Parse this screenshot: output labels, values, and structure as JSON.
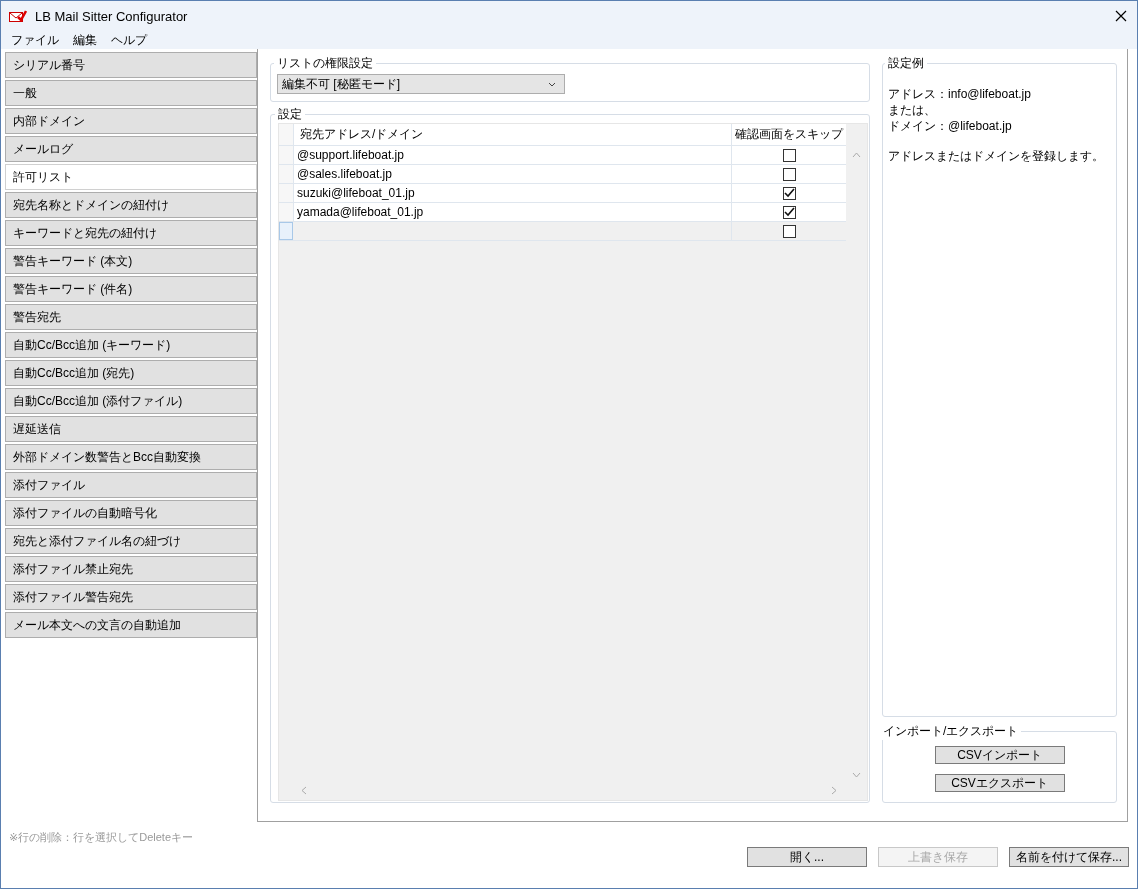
{
  "window": {
    "title": "LB Mail Sitter Configurator"
  },
  "menu": [
    "ファイル",
    "編集",
    "ヘルプ"
  ],
  "sidebar": {
    "items": [
      {
        "label": "シリアル番号",
        "selected": false
      },
      {
        "label": "一般",
        "selected": false
      },
      {
        "label": "内部ドメイン",
        "selected": false
      },
      {
        "label": "メールログ",
        "selected": false
      },
      {
        "label": "許可リスト",
        "selected": true
      },
      {
        "label": "宛先名称とドメインの紐付け",
        "selected": false
      },
      {
        "label": "キーワードと宛先の紐付け",
        "selected": false
      },
      {
        "label": "警告キーワード (本文)",
        "selected": false
      },
      {
        "label": "警告キーワード (件名)",
        "selected": false
      },
      {
        "label": "警告宛先",
        "selected": false
      },
      {
        "label": "自動Cc/Bcc追加 (キーワード)",
        "selected": false
      },
      {
        "label": "自動Cc/Bcc追加 (宛先)",
        "selected": false
      },
      {
        "label": "自動Cc/Bcc追加 (添付ファイル)",
        "selected": false
      },
      {
        "label": "遅延送信",
        "selected": false
      },
      {
        "label": "外部ドメイン数警告とBcc自動変換",
        "selected": false
      },
      {
        "label": "添付ファイル",
        "selected": false
      },
      {
        "label": "添付ファイルの自動暗号化",
        "selected": false
      },
      {
        "label": "宛先と添付ファイル名の紐づけ",
        "selected": false
      },
      {
        "label": "添付ファイル禁止宛先",
        "selected": false
      },
      {
        "label": "添付ファイル警告宛先",
        "selected": false
      },
      {
        "label": "メール本文への文言の自動追加",
        "selected": false
      }
    ]
  },
  "permission": {
    "title": "リストの権限設定",
    "value": "編集不可 [秘匿モード]"
  },
  "settings": {
    "title": "設定",
    "columns": [
      "宛先アドレス/ドメイン",
      "確認画面をスキップ"
    ],
    "rows": [
      {
        "kind": "entry",
        "address": "@support.lifeboat.jp",
        "skip": false
      },
      {
        "kind": "entry",
        "address": "@sales.lifeboat.jp",
        "skip": false
      },
      {
        "kind": "entry",
        "address": "suzuki@lifeboat_01.jp",
        "skip": true
      },
      {
        "kind": "entry",
        "address": "yamada@lifeboat_01.jp",
        "skip": true
      },
      {
        "kind": "new",
        "skip": false
      }
    ]
  },
  "example": {
    "title": "設定例",
    "paragraphs": [
      [
        "アドレス：info@lifeboat.jp",
        "または、",
        "ドメイン：@lifeboat.jp"
      ],
      [
        "アドレスまたはドメインを登録します。"
      ]
    ]
  },
  "import_export": {
    "title": "インポート/エクスポート",
    "buttons": [
      "CSVインポート",
      "CSVエクスポート"
    ]
  },
  "hint": "※行の削除：行を選択してDeleteキー",
  "footer_buttons": [
    {
      "label": "開く...",
      "disabled": false
    },
    {
      "label": "上書き保存",
      "disabled": true
    },
    {
      "label": "名前を付けて保存...",
      "disabled": false
    }
  ]
}
